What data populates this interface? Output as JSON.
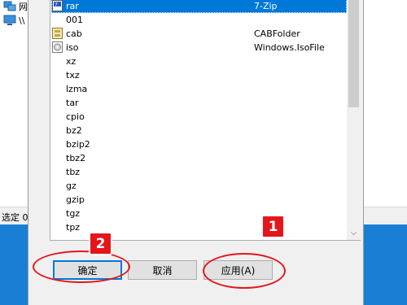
{
  "background_window": {
    "tree_items": [
      {
        "icon": "network-icon",
        "label": "网"
      },
      {
        "icon": "computer-icon",
        "label": "\\\\"
      }
    ],
    "status_text": "选定 0"
  },
  "dialog": {
    "file_types": [
      {
        "ext": "rar",
        "handler": "7-Zip",
        "icon": "7zip-file-icon",
        "selected": true
      },
      {
        "ext": "001",
        "handler": "",
        "icon": "",
        "selected": false
      },
      {
        "ext": "cab",
        "handler": "CABFolder",
        "icon": "cabinet-file-icon",
        "selected": false
      },
      {
        "ext": "iso",
        "handler": "Windows.IsoFile",
        "icon": "disc-image-icon",
        "selected": false
      },
      {
        "ext": "xz",
        "handler": "",
        "icon": "",
        "selected": false
      },
      {
        "ext": "txz",
        "handler": "",
        "icon": "",
        "selected": false
      },
      {
        "ext": "lzma",
        "handler": "",
        "icon": "",
        "selected": false
      },
      {
        "ext": "tar",
        "handler": "",
        "icon": "",
        "selected": false
      },
      {
        "ext": "cpio",
        "handler": "",
        "icon": "",
        "selected": false
      },
      {
        "ext": "bz2",
        "handler": "",
        "icon": "",
        "selected": false
      },
      {
        "ext": "bzip2",
        "handler": "",
        "icon": "",
        "selected": false
      },
      {
        "ext": "tbz2",
        "handler": "",
        "icon": "",
        "selected": false
      },
      {
        "ext": "tbz",
        "handler": "",
        "icon": "",
        "selected": false
      },
      {
        "ext": "gz",
        "handler": "",
        "icon": "",
        "selected": false
      },
      {
        "ext": "gzip",
        "handler": "",
        "icon": "",
        "selected": false
      },
      {
        "ext": "tgz",
        "handler": "",
        "icon": "",
        "selected": false
      },
      {
        "ext": "tpz",
        "handler": "",
        "icon": "",
        "selected": false
      }
    ],
    "buttons": {
      "ok": "确定",
      "cancel": "取消",
      "apply": "应用(A)"
    }
  },
  "annotations": {
    "badge_1": "1",
    "badge_2": "2",
    "color": "#e4161b"
  },
  "colors": {
    "selection": "#0078d7",
    "desktop": "#1a7fd4"
  }
}
